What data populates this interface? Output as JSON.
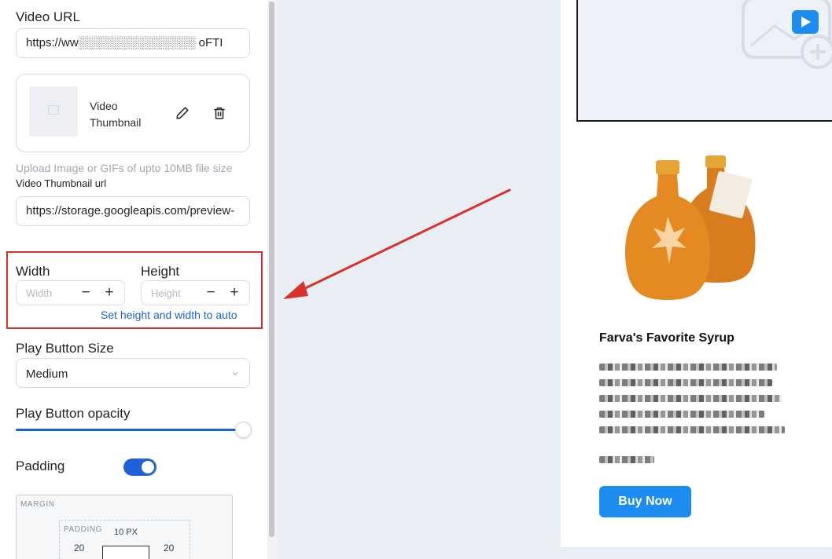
{
  "settings": {
    "video_url": {
      "label": "Video URL",
      "value": "https://ww░░░░░░░░░░░░░░ oFTI"
    },
    "thumbnail": {
      "label": "Video Thumbnail",
      "edit_icon": "pencil-icon",
      "delete_icon": "trash-icon"
    },
    "upload_hint": "Upload Image or GIFs of upto 10MB file size",
    "thumbnail_url": {
      "label": "Video Thumbnail url",
      "value": "https://storage.googleapis.com/preview-"
    },
    "dimensions": {
      "width_label": "Width",
      "width_placeholder": "Width",
      "height_label": "Height",
      "height_placeholder": "Height",
      "minus": "−",
      "plus": "+",
      "auto_link": "Set height and width to auto"
    },
    "play_button_size": {
      "label": "Play Button Size",
      "value": "Medium"
    },
    "play_button_opacity": {
      "label": "Play Button opacity",
      "value": 0.97
    },
    "padding": {
      "label": "Padding",
      "enabled": true
    },
    "spacing": {
      "margin_caption": "MARGIN",
      "padding_caption": "PADDING",
      "top": "10 PX",
      "left": "20",
      "right": "20"
    }
  },
  "preview": {
    "product_title": "Farva's Favorite Syrup",
    "buy_label": "Buy Now",
    "play_icon": "play-icon"
  },
  "colors": {
    "accent": "#2161d8",
    "button_blue": "#1d8cf0",
    "highlight_red": "#d8322c",
    "canvas_bg": "#e9eef4"
  }
}
